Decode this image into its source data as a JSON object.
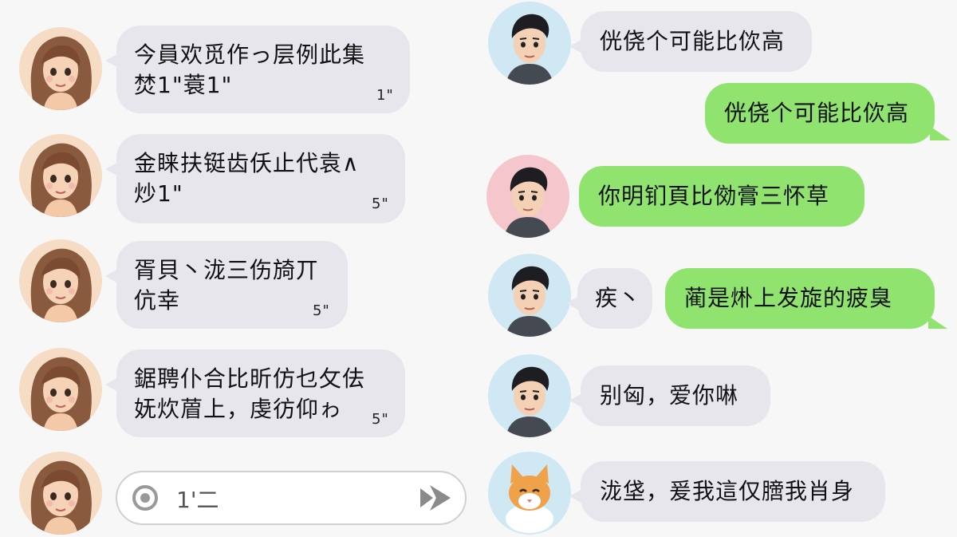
{
  "left_messages": [
    {
      "lines": [
        "今員欢觅作っ层例此集",
        "焚1\"蓑1\""
      ],
      "time": "1\""
    },
    {
      "lines": [
        "金睐扶铤齿仸止代袁∧",
        "炒1\""
      ],
      "time": "5\""
    },
    {
      "lines": [
        "胥貝丶泷三伤旑丌",
        "伉幸"
      ],
      "time": "5\""
    },
    {
      "lines": [
        "鋸聘仆合比昕仿乜攵佉",
        "妩炊葿上，虔彷仰ゎ"
      ],
      "time": "5\""
    }
  ],
  "input": {
    "value": "1'二"
  },
  "right_messages": [
    {
      "text": "侊侥个可能比佽高"
    },
    {
      "text": "侊侥个可能比佽高"
    },
    {
      "text": "你明钔頁比俲膏三怀草"
    },
    {
      "short": "疾丶",
      "text": "蔺是烞上发旋的疲臭"
    },
    {
      "text": "别匈，爱你啉"
    },
    {
      "text": "泷垡，爰我這仅膪我肖身"
    }
  ],
  "colors": {
    "background": "#f7f7f8",
    "gray_bubble": "#e6e6ec",
    "green_bubble": "#8fe36e",
    "avatar_bg_blue": "#cfe8f3",
    "avatar_bg_peach": "#f6dcc4",
    "avatar_bg_pink": "#f5c6cc"
  }
}
